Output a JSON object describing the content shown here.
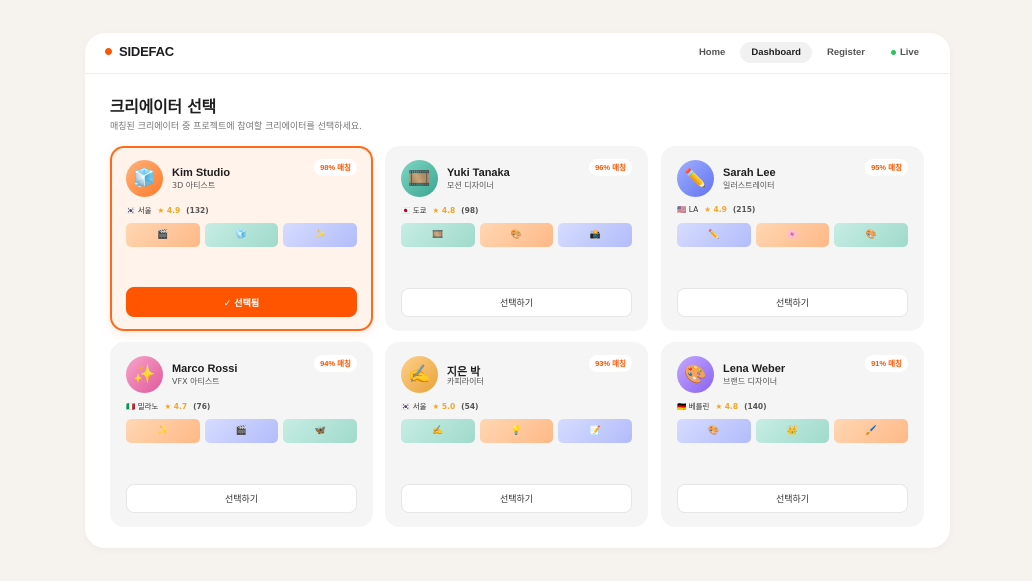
{
  "brand": {
    "name": "SIDEFAC"
  },
  "nav": {
    "home": "Home",
    "dashboard": "Dashboard",
    "register": "Register",
    "live": "Live"
  },
  "header": {
    "title": "크리에이터 선택",
    "subtitle": "매칭된 크리에이터 중 프로젝트에 참여할 크리에이터를 선택하세요."
  },
  "creators": [
    {
      "name": "Kim Studio",
      "role": "3D 아티스트",
      "match": "98% 매칭",
      "flag": "🇰🇷",
      "city": "서울",
      "rating": "★ 4.9",
      "reviews": "(132)",
      "avatar": "🧊",
      "thumbs": [
        "🎬",
        "🧊",
        "✨"
      ],
      "button": "✓ 선택됨",
      "selected": true
    },
    {
      "name": "Yuki Tanaka",
      "role": "모션 디자이너",
      "match": "96% 매칭",
      "flag": "🇯🇵",
      "city": "도쿄",
      "rating": "★ 4.8",
      "reviews": "(98)",
      "avatar": "🎞️",
      "thumbs": [
        "🎞️",
        "🎨",
        "📸"
      ],
      "button": "선택하기",
      "selected": false
    },
    {
      "name": "Sarah Lee",
      "role": "일러스트레이터",
      "match": "95% 매칭",
      "flag": "🇺🇸",
      "city": "LA",
      "rating": "★ 4.9",
      "reviews": "(215)",
      "avatar": "✏️",
      "thumbs": [
        "✏️",
        "🌸",
        "🎨"
      ],
      "button": "선택하기",
      "selected": false
    },
    {
      "name": "Marco Rossi",
      "role": "VFX 아티스트",
      "match": "94% 매칭",
      "flag": "🇮🇹",
      "city": "밀라노",
      "rating": "★ 4.7",
      "reviews": "(76)",
      "avatar": "✨",
      "thumbs": [
        "✨",
        "🎬",
        "🦋"
      ],
      "button": "선택하기",
      "selected": false
    },
    {
      "name": "지은 박",
      "role": "카피라이터",
      "match": "93% 매칭",
      "flag": "🇰🇷",
      "city": "서울",
      "rating": "★ 5.0",
      "reviews": "(54)",
      "avatar": "✍️",
      "thumbs": [
        "✍️",
        "💡",
        "📝"
      ],
      "button": "선택하기",
      "selected": false
    },
    {
      "name": "Lena Weber",
      "role": "브랜드 디자이너",
      "match": "91% 매칭",
      "flag": "🇩🇪",
      "city": "베를린",
      "rating": "★ 4.8",
      "reviews": "(140)",
      "avatar": "🎨",
      "thumbs": [
        "🎨",
        "👑",
        "🖌️"
      ],
      "button": "선택하기",
      "selected": false
    }
  ],
  "colors": {
    "accent": "#ff5500",
    "live": "#22c55e",
    "background": "#f6f3ee"
  }
}
